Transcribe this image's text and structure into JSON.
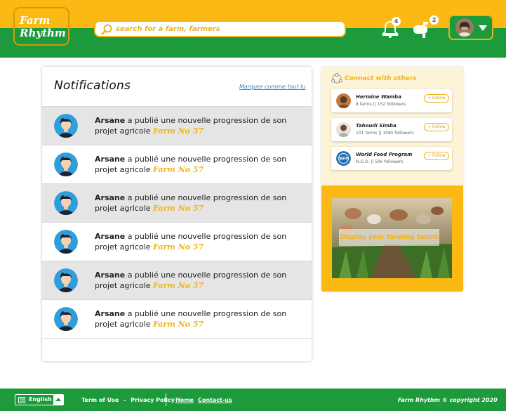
{
  "brand": {
    "line1": "Farm",
    "line2": "Rhythm"
  },
  "search": {
    "placeholder": "search for a farm, farmers"
  },
  "header": {
    "notifications_count": "4",
    "messages_count": "2"
  },
  "notifications": {
    "title": "Notifications",
    "mark_all_read": "Marquer comme tout lu",
    "items": [
      {
        "user": "Arsane",
        "text": " a publié une nouvelle progression de son projet agricole ",
        "farm": "Farm No 57",
        "shaded": true
      },
      {
        "user": "Arsane",
        "text": " a publié une nouvelle progression de son projet agricole ",
        "farm": "Farm No 57",
        "shaded": false
      },
      {
        "user": "Arsane",
        "text": " a publié une nouvelle progression de son projet agricole ",
        "farm": "Farm No 57",
        "shaded": true
      },
      {
        "user": "Arsane",
        "text": " a publié une nouvelle progression de son projet agricole ",
        "farm": "Farm No 57",
        "shaded": false
      },
      {
        "user": "Arsane",
        "text": " a publié une nouvelle progression de son projet agricole ",
        "farm": "Farm No 57",
        "shaded": true
      },
      {
        "user": "Arsane",
        "text": " a publié une nouvelle progression de son projet agricole ",
        "farm": "Farm No 57",
        "shaded": false
      }
    ]
  },
  "connect": {
    "title": "Connect with others",
    "people": [
      {
        "name": "Hermine Wamba",
        "info": "8 farms || 152 followers",
        "follow": "+ Follow"
      },
      {
        "name": "Tahoudi Simba",
        "info": "101 farms || 1085 followers",
        "follow": "+ Follow"
      },
      {
        "name": "World Food Program",
        "info": "N.G.O.  || 50k followers",
        "follow": "+ Follow"
      }
    ]
  },
  "talent": {
    "label": "Display your farming talent"
  },
  "footer": {
    "language": "English",
    "terms": "Term of Use",
    "dash": "-",
    "privacy": "Privacy Policy",
    "home": "Home",
    "contact": "Contact-us",
    "copyright": "Farm Rhythm © copyright 2020"
  },
  "colors": {
    "yellow": "#fdb913",
    "green": "#1d9a3c",
    "accent_text": "#f2b413",
    "link_blue": "#3a86c8"
  }
}
